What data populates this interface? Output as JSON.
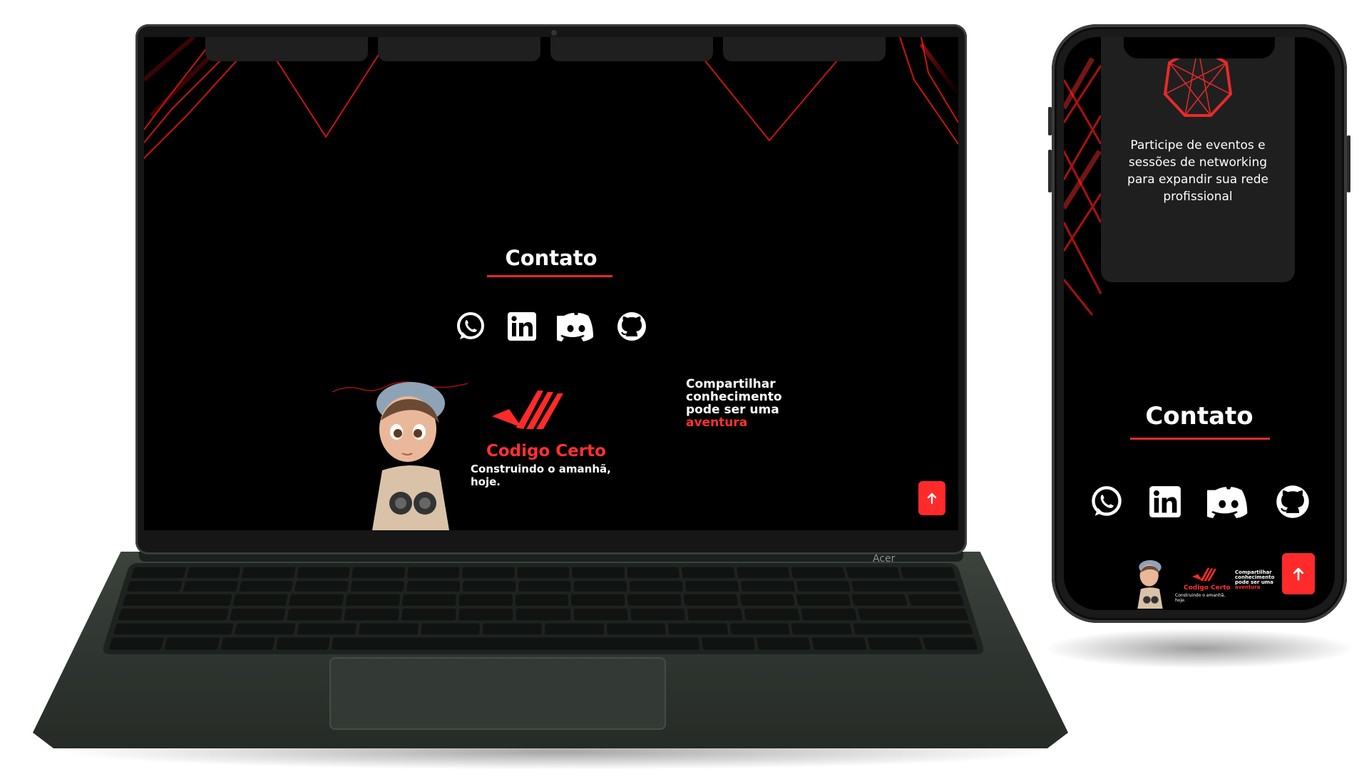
{
  "laptop": {
    "screen": {
      "section_title": "Contato",
      "social_links": [
        {
          "name": "whatsapp-icon"
        },
        {
          "name": "linkedin-icon"
        },
        {
          "name": "discord-icon"
        },
        {
          "name": "github-icon"
        }
      ],
      "banner": {
        "logo_name": "Codigo Certo",
        "logo_tagline": "Construindo o amanhã, hoje.",
        "slogan_lines": [
          "Compartilhar",
          "conhecimento",
          "pode ser uma"
        ],
        "slogan_accent": "aventura"
      },
      "scroll_top_icon": "arrow-up-icon"
    },
    "keyboard_brand": "Acer"
  },
  "phone": {
    "card_text": "Participe de eventos e sessões de networking para expandir sua rede profissional",
    "section_title": "Contato",
    "social_links": [
      {
        "name": "whatsapp-icon"
      },
      {
        "name": "linkedin-icon"
      },
      {
        "name": "discord-icon"
      },
      {
        "name": "github-icon"
      }
    ],
    "banner": {
      "logo_name": "Codigo Certo",
      "logo_tagline": "Construindo o amanhã, hoje.",
      "slogan_lines": [
        "Compartilhar",
        "conhecimento",
        "pode ser uma"
      ],
      "slogan_accent": "aventura"
    },
    "scroll_top_icon": "arrow-up-icon"
  },
  "colors": {
    "accent": "#ff2a2a",
    "background": "#000000",
    "card": "#1f1f1f",
    "text": "#ffffff"
  }
}
